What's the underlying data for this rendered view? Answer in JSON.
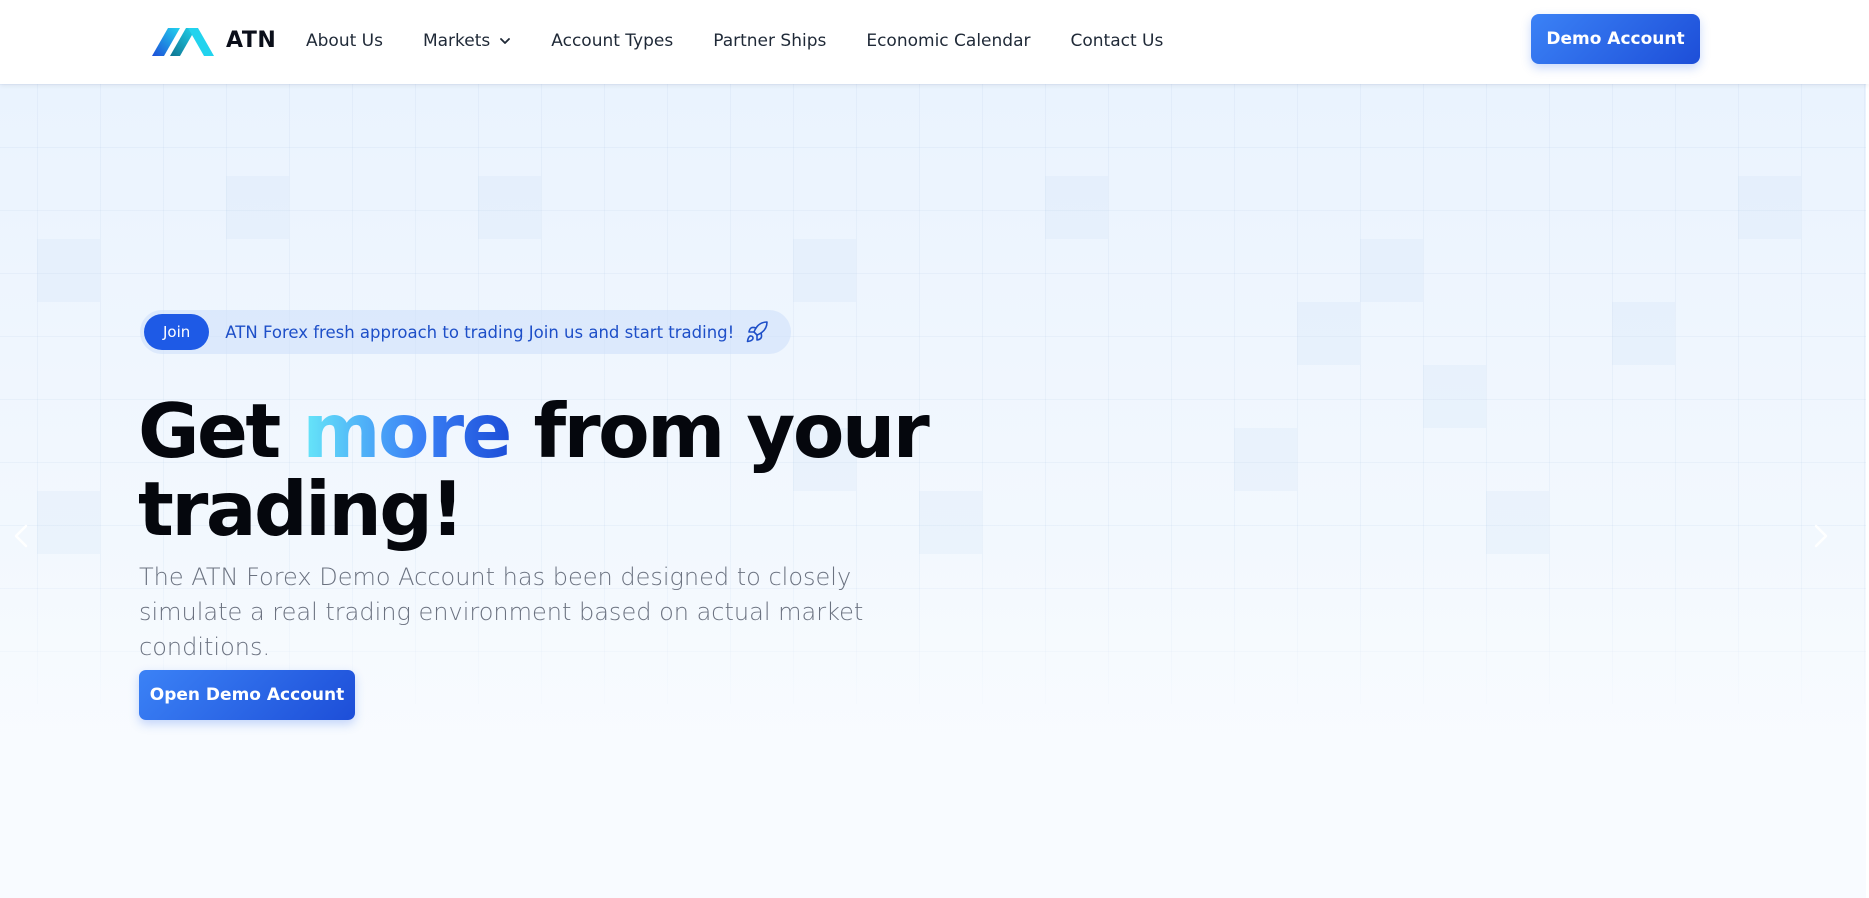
{
  "header": {
    "logo_text": "ATN",
    "nav": [
      {
        "label": "About Us"
      },
      {
        "label": "Markets",
        "has_dropdown": true
      },
      {
        "label": "Account Types"
      },
      {
        "label": "Partner Ships"
      },
      {
        "label": "Economic Calendar"
      },
      {
        "label": "Contact Us"
      }
    ],
    "demo_button": "Demo Account"
  },
  "hero": {
    "announcement": {
      "badge": "Join",
      "text": "ATN Forex fresh approach to trading Join us and start trading!",
      "icon": "rocket-icon"
    },
    "headline": {
      "prefix": "Get ",
      "highlight": "more",
      "suffix": " from your trading!"
    },
    "description": "The ATN Forex Demo Account has been designed to closely simulate a real trading environment based on actual market conditions.",
    "cta": "Open Demo Account"
  },
  "colors": {
    "primary": "#1e5ae6",
    "primary_gradient_start": "#3b82f6",
    "primary_gradient_end": "#1d4ed8",
    "accent_cyan": "#67e8f9",
    "headline": "#05070d",
    "body_text": "#6b7280",
    "hero_background": "#eaf3fe"
  }
}
